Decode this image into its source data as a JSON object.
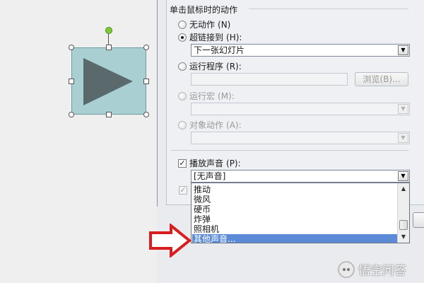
{
  "action_settings": {
    "group_title": "单击鼠标时的动作",
    "options": {
      "none": "无动作",
      "none_key": "(N)",
      "hyperlink": "超链接到",
      "hyperlink_key": "(H):",
      "hyperlink_value": "下一张幻灯片",
      "run_program": "运行程序",
      "run_program_key": "(R):",
      "browse_button": "浏览(B)...",
      "run_macro": "运行宏",
      "run_macro_key": "(M):",
      "object_action": "对象动作",
      "object_action_key": "(A):"
    },
    "selected_option": "hyperlink",
    "play_sound": {
      "label": "播放声音",
      "key": "(P):",
      "checked": true,
      "value": "[无声音]",
      "list_items": [
        "推动",
        "微风",
        "硬币",
        "炸弹",
        "照相机",
        "其他声音..."
      ],
      "highlighted_item": "其他声音..."
    },
    "highlight_click_checked": true
  },
  "slide_shape": {
    "icon": "play-triangle-icon",
    "fill": "#a9cfd3",
    "triangle_color": "#5a6a6c"
  },
  "annotation": {
    "arrow_color": "#d81e1e"
  },
  "watermark": {
    "text": "悟空问答"
  }
}
